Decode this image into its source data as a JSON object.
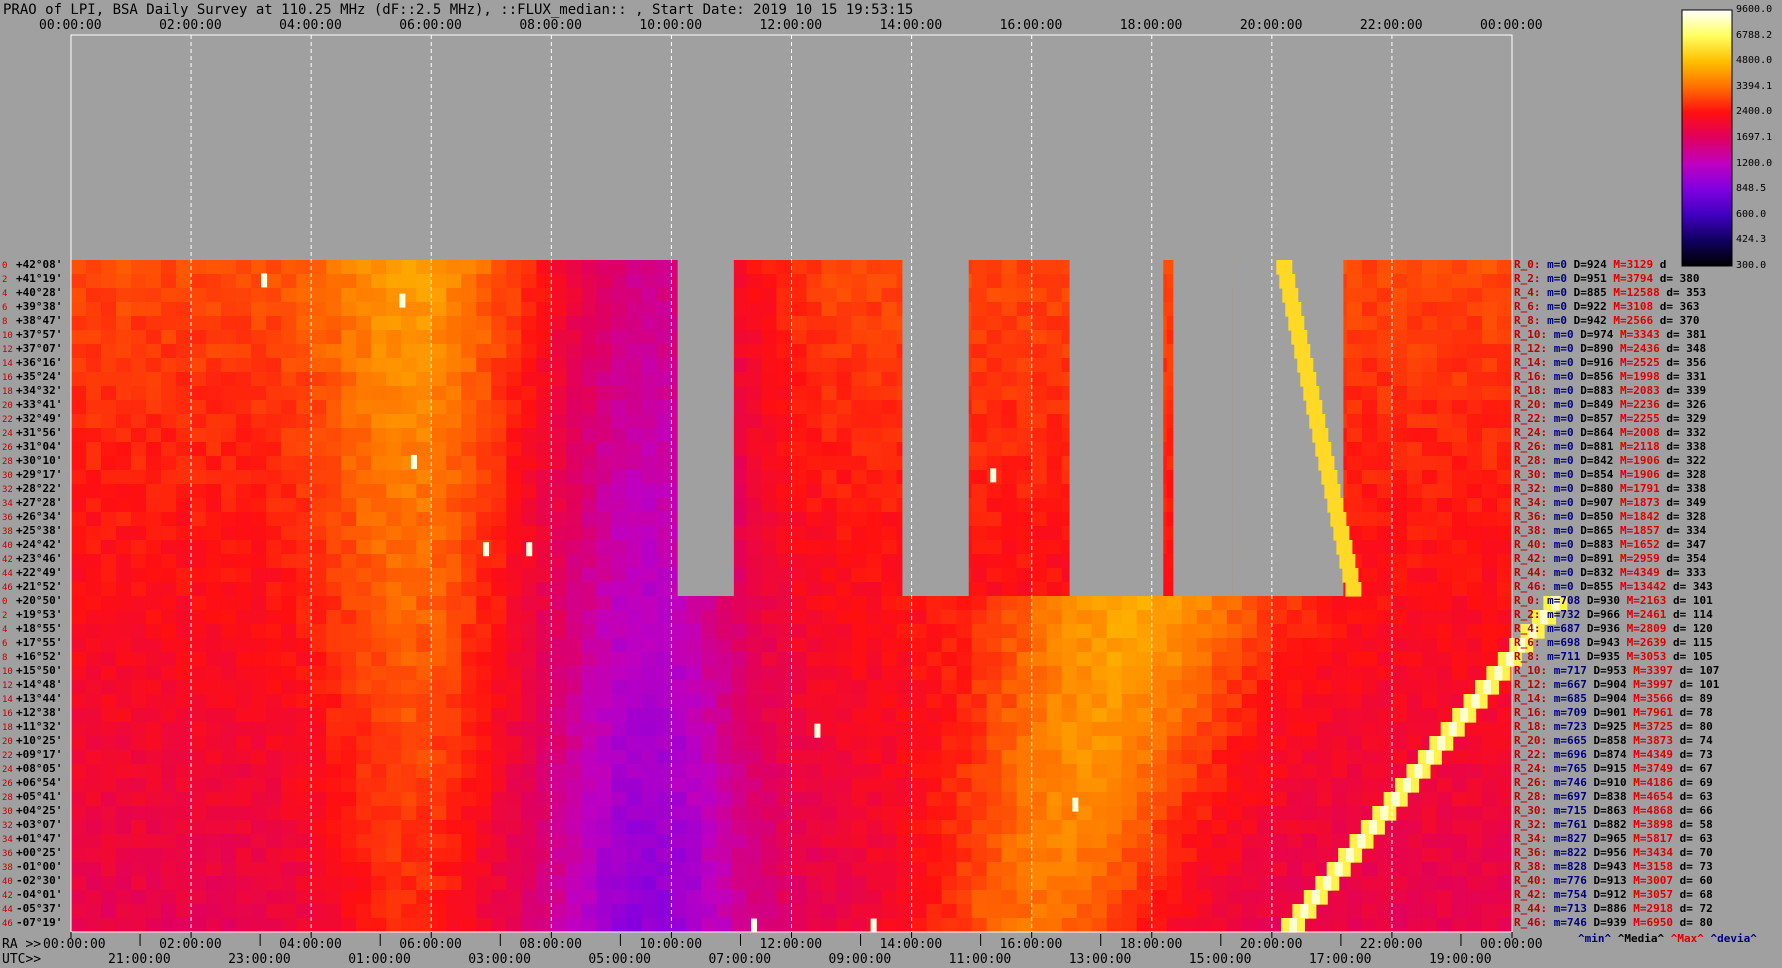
{
  "title": "PRAO of LPI, BSA Daily Survey at 110.25 MHz (dF::2.5 MHz), ::FLUX_median:: , Start Date: 2019 10 15 19:53:15",
  "top_ticks": [
    "00:00:00",
    "02:00:00",
    "04:00:00",
    "06:00:00",
    "08:00:00",
    "10:00:00",
    "12:00:00",
    "14:00:00",
    "16:00:00",
    "18:00:00",
    "20:00:00",
    "22:00:00",
    "00:00:00"
  ],
  "ra_axis": {
    "label": "RA >>",
    "ticks": [
      "00:00:00",
      "02:00:00",
      "04:00:00",
      "06:00:00",
      "08:00:00",
      "10:00:00",
      "12:00:00",
      "14:00:00",
      "16:00:00",
      "18:00:00",
      "20:00:00",
      "22:00:00",
      "00:00:00"
    ]
  },
  "utc_axis": {
    "label": "UTC>>",
    "ticks": [
      "21:00:00",
      "23:00:00",
      "01:00:00",
      "03:00:00",
      "05:00:00",
      "07:00:00",
      "09:00:00",
      "11:00:00",
      "13:00:00",
      "15:00:00",
      "17:00:00",
      "19:00:00"
    ]
  },
  "colorbar": {
    "labels": [
      "9600.0",
      "6788.2",
      "4800.0",
      "3394.1",
      "2400.0",
      "1697.1",
      "1200.0",
      "848.5",
      "600.0",
      "424.3",
      "300.0"
    ],
    "stops": [
      "#ffffff",
      "#ffff60",
      "#ffc000",
      "#ff7000",
      "#ff1010",
      "#e00060",
      "#c000c0",
      "#8000e0",
      "#4000c0",
      "#100060",
      "#000000"
    ]
  },
  "declinations": [
    "+42°08'",
    "+41°19'",
    "+40°28'",
    "+39°38'",
    "+38°47'",
    "+37°57'",
    "+37°07'",
    "+36°16'",
    "+35°24'",
    "+34°32'",
    "+33°41'",
    "+32°49'",
    "+31°56'",
    "+31°04'",
    "+30°10'",
    "+29°17'",
    "+28°22'",
    "+27°28'",
    "+26°34'",
    "+25°38'",
    "+24°42'",
    "+23°46'",
    "+22°49'",
    "+21°52'",
    "+20°50'",
    "+19°53'",
    "+18°55'",
    "+17°55'",
    "+16°52'",
    "+15°50'",
    "+14°48'",
    "+13°44'",
    "+12°38'",
    "+11°32'",
    "+10°25'",
    "+09°17'",
    "+08°05'",
    "+06°54'",
    "+05°41'",
    "+04°25'",
    "+03°07'",
    "+01°47'",
    "+00°25'",
    "-01°00'",
    "-02°30'",
    "-04°01'",
    "-05°37'",
    "-07°19'"
  ],
  "row_indices": [
    "0",
    "2",
    "4",
    "6",
    "8",
    "10",
    "12",
    "14",
    "16",
    "18",
    "20",
    "22",
    "24",
    "26",
    "28",
    "30",
    "32",
    "34",
    "36",
    "38",
    "40",
    "42",
    "44",
    "46",
    "0",
    "2",
    "4",
    "6",
    "8",
    "10",
    "12",
    "14",
    "16",
    "18",
    "20",
    "22",
    "24",
    "26",
    "28",
    "30",
    "32",
    "34",
    "36",
    "38",
    "40",
    "42",
    "44",
    "46"
  ],
  "stats": [
    {
      "r": "R_0:",
      "m": "m=0",
      "D": "D=924",
      "M": "M=3129",
      "d": "d"
    },
    {
      "r": "R_2:",
      "m": "m=0",
      "D": "D=951",
      "M": "M=3794",
      "d": "d= 380"
    },
    {
      "r": "R_4:",
      "m": "m=0",
      "D": "D=885",
      "M": "M=12588",
      "d": "d= 353"
    },
    {
      "r": "R_6:",
      "m": "m=0",
      "D": "D=922",
      "M": "M=3108",
      "d": "d= 363"
    },
    {
      "r": "R_8:",
      "m": "m=0",
      "D": "D=942",
      "M": "M=2566",
      "d": "d= 370"
    },
    {
      "r": "R_10:",
      "m": "m=0",
      "D": "D=974",
      "M": "M=3343",
      "d": "d= 381"
    },
    {
      "r": "R_12:",
      "m": "m=0",
      "D": "D=890",
      "M": "M=2436",
      "d": "d= 348"
    },
    {
      "r": "R_14:",
      "m": "m=0",
      "D": "D=916",
      "M": "M=2525",
      "d": "d= 356"
    },
    {
      "r": "R_16:",
      "m": "m=0",
      "D": "D=856",
      "M": "M=1998",
      "d": "d= 331"
    },
    {
      "r": "R_18:",
      "m": "m=0",
      "D": "D=883",
      "M": "M=2083",
      "d": "d= 339"
    },
    {
      "r": "R_20:",
      "m": "m=0",
      "D": "D=849",
      "M": "M=2236",
      "d": "d= 326"
    },
    {
      "r": "R_22:",
      "m": "m=0",
      "D": "D=857",
      "M": "M=2255",
      "d": "d= 329"
    },
    {
      "r": "R_24:",
      "m": "m=0",
      "D": "D=864",
      "M": "M=2008",
      "d": "d= 332"
    },
    {
      "r": "R_26:",
      "m": "m=0",
      "D": "D=881",
      "M": "M=2118",
      "d": "d= 338"
    },
    {
      "r": "R_28:",
      "m": "m=0",
      "D": "D=842",
      "M": "M=1906",
      "d": "d= 322"
    },
    {
      "r": "R_30:",
      "m": "m=0",
      "D": "D=854",
      "M": "M=1906",
      "d": "d= 328"
    },
    {
      "r": "R_32:",
      "m": "m=0",
      "D": "D=880",
      "M": "M=1791",
      "d": "d= 338"
    },
    {
      "r": "R_34:",
      "m": "m=0",
      "D": "D=907",
      "M": "M=1873",
      "d": "d= 349"
    },
    {
      "r": "R_36:",
      "m": "m=0",
      "D": "D=850",
      "M": "M=1842",
      "d": "d= 328"
    },
    {
      "r": "R_38:",
      "m": "m=0",
      "D": "D=865",
      "M": "M=1857",
      "d": "d= 334"
    },
    {
      "r": "R_40:",
      "m": "m=0",
      "D": "D=883",
      "M": "M=1652",
      "d": "d= 347"
    },
    {
      "r": "R_42:",
      "m": "m=0",
      "D": "D=891",
      "M": "M=2959",
      "d": "d= 354"
    },
    {
      "r": "R_44:",
      "m": "m=0",
      "D": "D=832",
      "M": "M=4349",
      "d": "d= 333"
    },
    {
      "r": "R_46:",
      "m": "m=0",
      "D": "D=855",
      "M": "M=13442",
      "d": "d= 343"
    },
    {
      "r": "R_0:",
      "m": "m=708",
      "D": "D=930",
      "M": "M=2163",
      "d": "d= 101"
    },
    {
      "r": "R_2:",
      "m": "m=732",
      "D": "D=966",
      "M": "M=2461",
      "d": "d= 114"
    },
    {
      "r": "R_4:",
      "m": "m=687",
      "D": "D=936",
      "M": "M=2809",
      "d": "d= 120"
    },
    {
      "r": "R_6:",
      "m": "m=698",
      "D": "D=943",
      "M": "M=2639",
      "d": "d= 115"
    },
    {
      "r": "R_8:",
      "m": "m=711",
      "D": "D=935",
      "M": "M=3053",
      "d": "d= 105"
    },
    {
      "r": "R_10:",
      "m": "m=717",
      "D": "D=953",
      "M": "M=3397",
      "d": "d= 107"
    },
    {
      "r": "R_12:",
      "m": "m=667",
      "D": "D=904",
      "M": "M=3997",
      "d": "d= 101"
    },
    {
      "r": "R_14:",
      "m": "m=685",
      "D": "D=904",
      "M": "M=3566",
      "d": "d= 89"
    },
    {
      "r": "R_16:",
      "m": "m=709",
      "D": "D=901",
      "M": "M=7961",
      "d": "d= 78"
    },
    {
      "r": "R_18:",
      "m": "m=723",
      "D": "D=925",
      "M": "M=3725",
      "d": "d= 80"
    },
    {
      "r": "R_20:",
      "m": "m=665",
      "D": "D=858",
      "M": "M=3873",
      "d": "d= 74"
    },
    {
      "r": "R_22:",
      "m": "m=696",
      "D": "D=874",
      "M": "M=4349",
      "d": "d= 73"
    },
    {
      "r": "R_24:",
      "m": "m=765",
      "D": "D=915",
      "M": "M=3749",
      "d": "d= 67"
    },
    {
      "r": "R_26:",
      "m": "m=746",
      "D": "D=910",
      "M": "M=4186",
      "d": "d= 69"
    },
    {
      "r": "R_28:",
      "m": "m=697",
      "D": "D=838",
      "M": "M=4654",
      "d": "d= 63"
    },
    {
      "r": "R_30:",
      "m": "m=715",
      "D": "D=863",
      "M": "M=4868",
      "d": "d= 66"
    },
    {
      "r": "R_32:",
      "m": "m=761",
      "D": "D=882",
      "M": "M=3898",
      "d": "d= 58"
    },
    {
      "r": "R_34:",
      "m": "m=827",
      "D": "D=965",
      "M": "M=5817",
      "d": "d= 63"
    },
    {
      "r": "R_36:",
      "m": "m=822",
      "D": "D=956",
      "M": "M=3434",
      "d": "d= 70"
    },
    {
      "r": "R_38:",
      "m": "m=828",
      "D": "D=943",
      "M": "M=3158",
      "d": "d= 73"
    },
    {
      "r": "R_40:",
      "m": "m=776",
      "D": "D=913",
      "M": "M=3007",
      "d": "d= 60"
    },
    {
      "r": "R_42:",
      "m": "m=754",
      "D": "D=912",
      "M": "M=3057",
      "d": "d= 68"
    },
    {
      "r": "R_44:",
      "m": "m=713",
      "D": "D=886",
      "M": "M=2918",
      "d": "d= 72"
    },
    {
      "r": "R_46:",
      "m": "m=746",
      "D": "D=939",
      "M": "M=6950",
      "d": "d= 80"
    }
  ],
  "legend_footer": {
    "min": "^min^",
    "median": "^Media^",
    "max": "^Max^",
    "devia": "^devia^"
  },
  "chart_data": {
    "type": "heatmap",
    "title": "PRAO of LPI, BSA Daily Survey at 110.25 MHz (dF::2.5 MHz), ::FLUX_median:: , Start Date: 2019 10 15 19:53:15",
    "x_axis_ra": [
      "00:00:00",
      "02:00:00",
      "04:00:00",
      "06:00:00",
      "08:00:00",
      "10:00:00",
      "12:00:00",
      "14:00:00",
      "16:00:00",
      "18:00:00",
      "20:00:00",
      "22:00:00",
      "00:00:00"
    ],
    "x_axis_utc": [
      "21:00:00",
      "23:00:00",
      "01:00:00",
      "03:00:00",
      "05:00:00",
      "07:00:00",
      "09:00:00",
      "11:00:00",
      "13:00:00",
      "15:00:00",
      "17:00:00",
      "19:00:00"
    ],
    "y_axis_dec_range": [
      "+42°08'",
      "-07°19'"
    ],
    "color_scale": "log",
    "color_range": [
      300.0,
      9600.0
    ],
    "grid": true
  }
}
